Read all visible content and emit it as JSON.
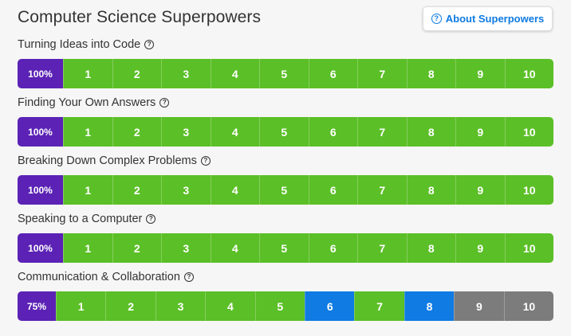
{
  "page_title": "Computer Science Superpowers",
  "about_button": {
    "label": "About Superpowers",
    "icon": "question-circle-icon"
  },
  "colors": {
    "percent": "#5b22b5",
    "completed": "#5bbf27",
    "in_progress": "#0f7be3",
    "not_started": "#7c7c7c",
    "accent": "#0f7be3"
  },
  "skills": [
    {
      "name": "Turning Ideas into Code",
      "percent": "100%",
      "levels": [
        {
          "n": "1",
          "state": "done"
        },
        {
          "n": "2",
          "state": "done"
        },
        {
          "n": "3",
          "state": "done"
        },
        {
          "n": "4",
          "state": "done"
        },
        {
          "n": "5",
          "state": "done"
        },
        {
          "n": "6",
          "state": "done"
        },
        {
          "n": "7",
          "state": "done"
        },
        {
          "n": "8",
          "state": "done"
        },
        {
          "n": "9",
          "state": "done"
        },
        {
          "n": "10",
          "state": "done"
        }
      ]
    },
    {
      "name": "Finding Your Own Answers",
      "percent": "100%",
      "levels": [
        {
          "n": "1",
          "state": "done"
        },
        {
          "n": "2",
          "state": "done"
        },
        {
          "n": "3",
          "state": "done"
        },
        {
          "n": "4",
          "state": "done"
        },
        {
          "n": "5",
          "state": "done"
        },
        {
          "n": "6",
          "state": "done"
        },
        {
          "n": "7",
          "state": "done"
        },
        {
          "n": "8",
          "state": "done"
        },
        {
          "n": "9",
          "state": "done"
        },
        {
          "n": "10",
          "state": "done"
        }
      ]
    },
    {
      "name": "Breaking Down Complex Problems",
      "percent": "100%",
      "levels": [
        {
          "n": "1",
          "state": "done"
        },
        {
          "n": "2",
          "state": "done"
        },
        {
          "n": "3",
          "state": "done"
        },
        {
          "n": "4",
          "state": "done"
        },
        {
          "n": "5",
          "state": "done"
        },
        {
          "n": "6",
          "state": "done"
        },
        {
          "n": "7",
          "state": "done"
        },
        {
          "n": "8",
          "state": "done"
        },
        {
          "n": "9",
          "state": "done"
        },
        {
          "n": "10",
          "state": "done"
        }
      ]
    },
    {
      "name": "Speaking to a Computer",
      "percent": "100%",
      "levels": [
        {
          "n": "1",
          "state": "done"
        },
        {
          "n": "2",
          "state": "done"
        },
        {
          "n": "3",
          "state": "done"
        },
        {
          "n": "4",
          "state": "done"
        },
        {
          "n": "5",
          "state": "done"
        },
        {
          "n": "6",
          "state": "done"
        },
        {
          "n": "7",
          "state": "done"
        },
        {
          "n": "8",
          "state": "done"
        },
        {
          "n": "9",
          "state": "done"
        },
        {
          "n": "10",
          "state": "done"
        }
      ]
    },
    {
      "name": "Communication & Collaboration",
      "percent": "75%",
      "levels": [
        {
          "n": "1",
          "state": "done"
        },
        {
          "n": "2",
          "state": "done"
        },
        {
          "n": "3",
          "state": "done"
        },
        {
          "n": "4",
          "state": "done"
        },
        {
          "n": "5",
          "state": "done"
        },
        {
          "n": "6",
          "state": "current"
        },
        {
          "n": "7",
          "state": "done"
        },
        {
          "n": "8",
          "state": "current"
        },
        {
          "n": "9",
          "state": "locked"
        },
        {
          "n": "10",
          "state": "locked"
        }
      ]
    }
  ]
}
